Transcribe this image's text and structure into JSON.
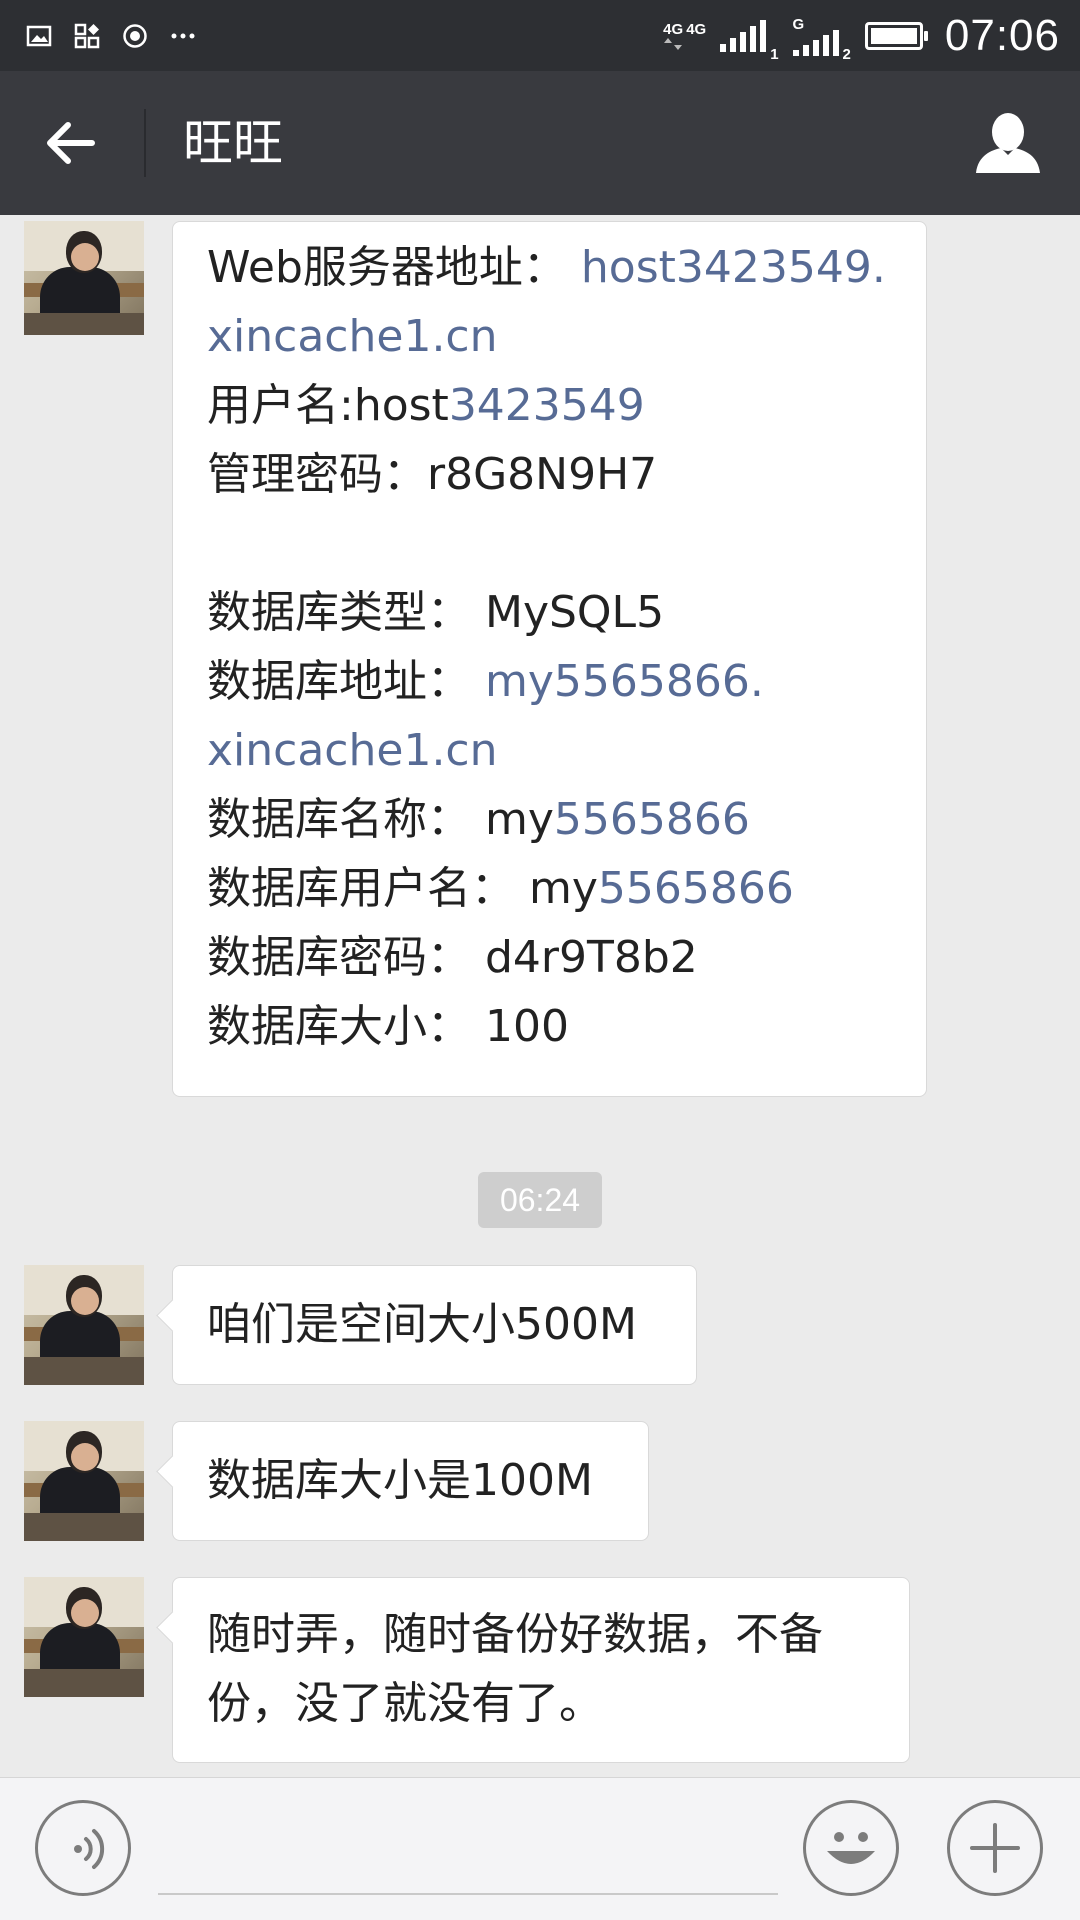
{
  "status_bar": {
    "time": "07:06",
    "network1": "4G",
    "network2": "4G",
    "sim1": "1",
    "sim2_net": "G",
    "sim2": "2"
  },
  "header": {
    "title": "旺旺"
  },
  "messages": [
    {
      "lines": [
        {
          "a": "Web服务器地址：  ",
          "b": "host3423549.",
          "c": ""
        },
        {
          "a": "",
          "b": "xincache1.cn",
          "c": ""
        },
        {
          "a": "用户名:host",
          "b": "3423549",
          "c": ""
        },
        {
          "a": "管理密码：r8G8N9H7",
          "b": "",
          "c": ""
        },
        {
          "a": "数据库类型：  MySQL5",
          "b": "",
          "c": ""
        },
        {
          "a": "数据库地址：  ",
          "b": "my5565866.",
          "c": ""
        },
        {
          "a": "",
          "b": "xincache1.cn",
          "c": ""
        },
        {
          "a": "数据库名称：  my",
          "b": "5565866",
          "c": ""
        },
        {
          "a": "数据库用户名：  my",
          "b": "5565866",
          "c": ""
        },
        {
          "a": "数据库密码：  d4r9T8b2",
          "b": "",
          "c": ""
        },
        {
          "a": "数据库大小：  100",
          "b": "",
          "c": ""
        }
      ]
    },
    {
      "text": "咱们是空间大小500M"
    },
    {
      "text": "数据库大小是100M"
    },
    {
      "line1": "随时弄，随时备份好数据，不备",
      "line2": "份，没了就没有了。"
    }
  ],
  "timestamp": "06:24",
  "icons": {
    "back": "arrow-left-icon",
    "profile": "person-icon",
    "voice": "voice-icon",
    "emoji": "smiley-icon",
    "more": "plus-icon"
  },
  "colors": {
    "header": "#393a3f",
    "status_bar": "#2d2f33",
    "background": "#ebebeb",
    "link": "#576b95"
  }
}
